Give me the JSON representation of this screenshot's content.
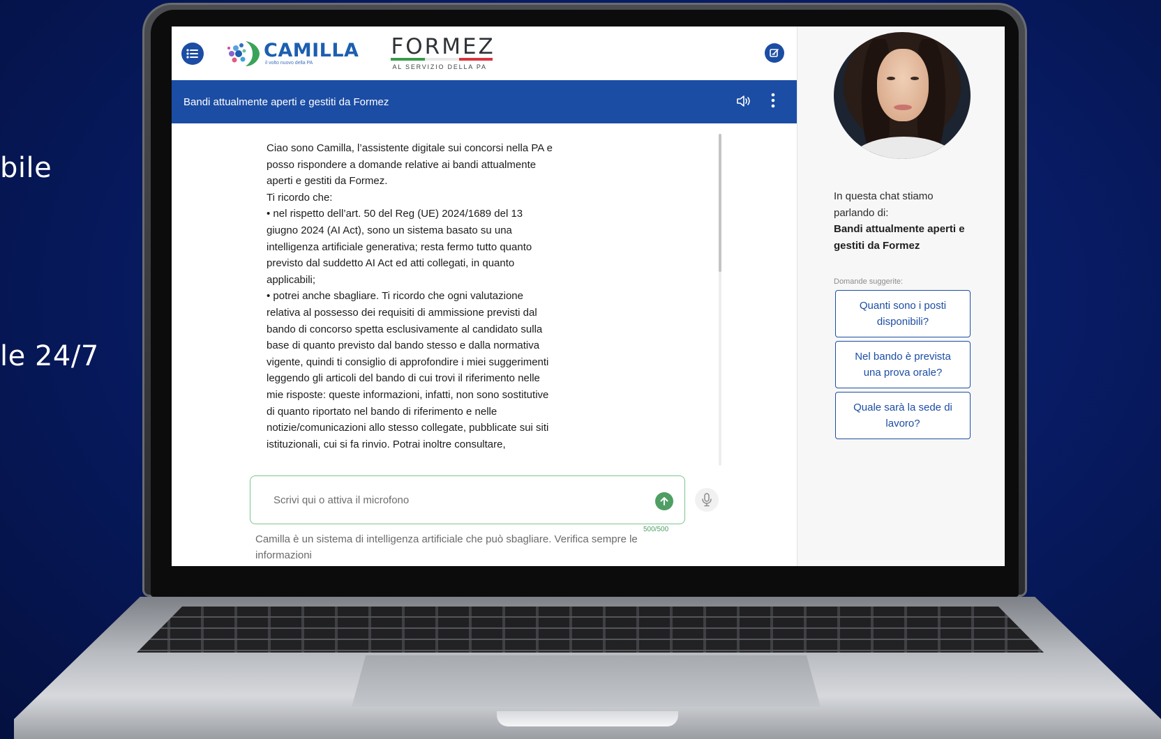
{
  "background": {
    "text_1": "bile",
    "text_2": "le 24/7"
  },
  "header": {
    "camilla_brand": "CAMILLA",
    "camilla_tagline": "il volto nuovo della PA",
    "formez_brand": "FORMEZ",
    "formez_tagline": "AL SERVIZIO DELLA PA"
  },
  "chat": {
    "title": "Bandi attualmente aperti e gestiti da Formez",
    "message": {
      "intro": "Ciao sono Camilla, l’assistente digitale sui concorsi nella PA e posso rispondere a domande relative ai bandi attualmente aperti e gestiti da Formez.",
      "reminder": "Ti ricordo che:",
      "bullet_1": "• nel rispetto dell’art. 50 del Reg (UE) 2024/1689 del 13 giugno 2024 (AI Act), sono un sistema basato su una intelligenza artificiale generativa; resta fermo tutto quanto previsto dal suddetto AI Act ed atti collegati, in quanto applicabili;",
      "bullet_2": "• potrei anche sbagliare. Ti ricordo che ogni valutazione relativa al possesso dei requisiti di ammissione previsti dal bando di concorso spetta esclusivamente al candidato sulla base di quanto previsto dal bando stesso e dalla normativa vigente, quindi ti consiglio di approfondire i miei suggerimenti leggendo gli articoli del bando di cui trovi il riferimento nelle mie risposte: queste informazioni, infatti, non sono sostitutive di quanto riportato nel bando di riferimento e nelle notizie/comunicazioni allo stesso collegate, pubblicate sui siti istituzionali, cui si fa rinvio. Potrai inoltre consultare,"
    },
    "input": {
      "placeholder": "Scrivi qui o attiva il microfono",
      "value": "",
      "char_count": "500/500"
    },
    "disclaimer": "Camilla è un sistema di intelligenza artificiale che può sbagliare. Verifica sempre le informazioni"
  },
  "sidebar": {
    "topic_intro": "In questa chat stiamo parlando di:",
    "topic_name": "Bandi attualmente aperti e gestiti da Formez",
    "suggestions_label": "Domande suggerite:",
    "suggestions": [
      "Quanti sono i posti disponibili?",
      "Nel bando è prevista una prova orale?",
      "Quale sarà la sede di lavoro?"
    ]
  },
  "colors": {
    "primary_blue": "#1c4da4",
    "accent_green": "#4f9e63",
    "background_navy": "#081c66"
  },
  "icons": {
    "menu": "menu-list-icon",
    "new_chat": "new-chat-icon",
    "audio": "speaker-icon",
    "more": "more-vertical-icon",
    "send": "send-arrow-up-icon",
    "mic": "microphone-icon"
  }
}
